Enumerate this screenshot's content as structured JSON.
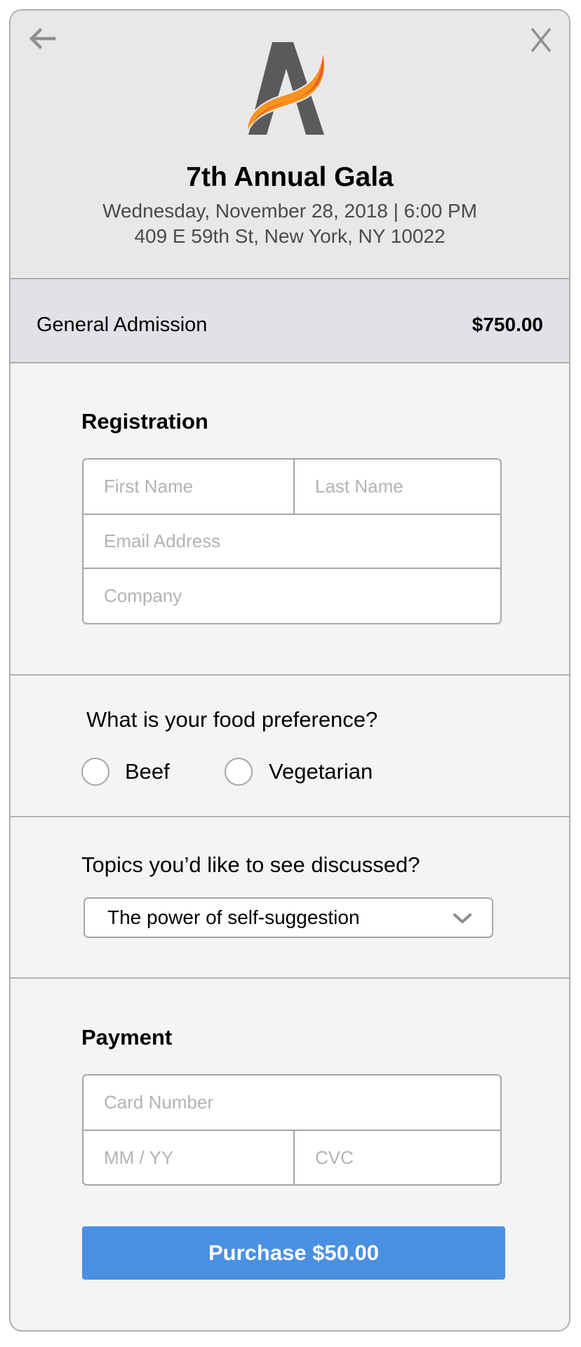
{
  "nav": {
    "back_icon": "arrow-left-icon",
    "close_icon": "close-x-icon"
  },
  "event": {
    "logo": "event-logo-letter-a-with-flame",
    "title": "7th Annual Gala",
    "datetime": "Wednesday, November 28, 2018 | 6:00 PM",
    "address": "409 E 59th St, New York, NY 10022"
  },
  "ticket": {
    "name": "General Admission",
    "price": "$750.00"
  },
  "registration": {
    "heading": "Registration",
    "first_name": {
      "value": "",
      "placeholder": "First Name"
    },
    "last_name": {
      "value": "",
      "placeholder": "Last Name"
    },
    "email": {
      "value": "",
      "placeholder": "Email Address"
    },
    "company": {
      "value": "",
      "placeholder": "Company"
    }
  },
  "food": {
    "question": "What is your food preference?",
    "options": [
      {
        "label": "Beef",
        "selected": false
      },
      {
        "label": "Vegetarian",
        "selected": false
      }
    ]
  },
  "topics": {
    "question": "Topics you’d like to see discussed?",
    "selected": "The power of self-suggestion",
    "icon": "chevron-down-icon"
  },
  "payment": {
    "heading": "Payment",
    "card_number": {
      "value": "",
      "placeholder": "Card Number"
    },
    "expiry": {
      "value": "",
      "placeholder": "MM / YY"
    },
    "cvc": {
      "value": "",
      "placeholder": "CVC"
    }
  },
  "purchase": {
    "label": "Purchase $50.00"
  },
  "colors": {
    "header_bg": "#e7e8ea",
    "admission_bg": "#e1e1e6",
    "body_bg": "#f4f4f6",
    "primary_button": "#4a90e2",
    "logo_gray": "#5a5a5c",
    "logo_orange": "#f7931e",
    "logo_red": "#ea4b2a"
  }
}
